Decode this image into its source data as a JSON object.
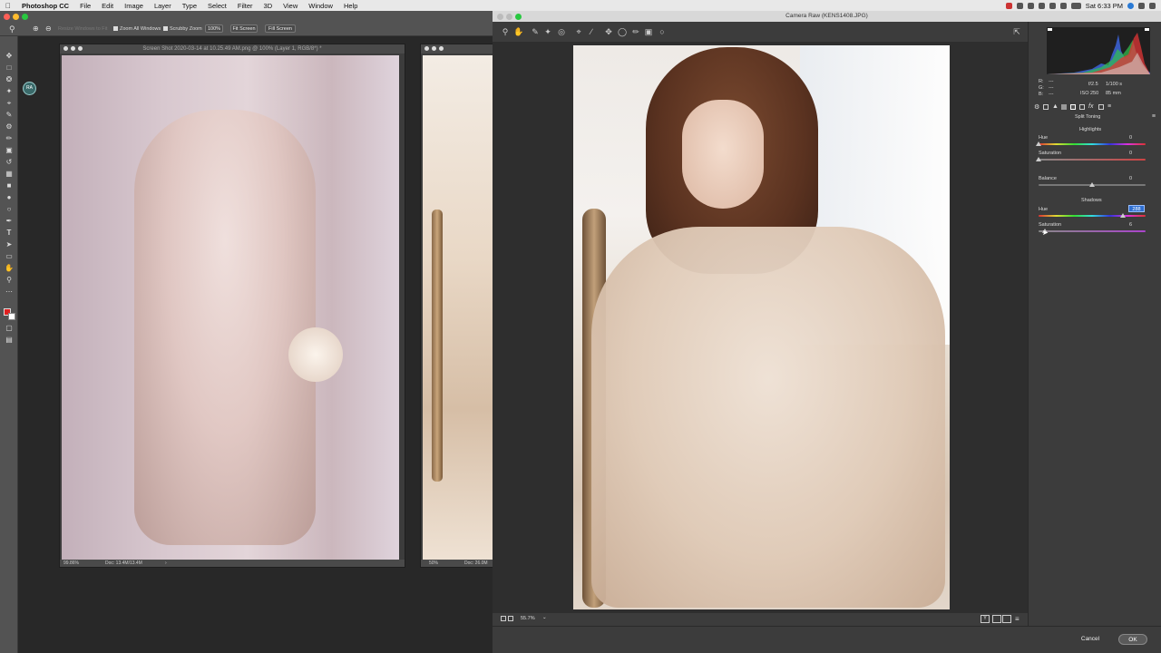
{
  "menubar": {
    "app": "Photoshop CC",
    "items": [
      "File",
      "Edit",
      "Image",
      "Layer",
      "Type",
      "Select",
      "Filter",
      "3D",
      "View",
      "Window",
      "Help"
    ],
    "clock": "Sat 6:33 PM"
  },
  "options_bar": {
    "resize_windows": "Resize Windows to Fit",
    "zoom_all": "Zoom All Windows",
    "scrubby": "Scrubby Zoom",
    "zoom_pct": "100%",
    "fit_screen": "Fit Screen",
    "fill_screen": "Fill Screen"
  },
  "doc1": {
    "title": "Screen Shot 2020-03-14 at 10.25.49 AM.png @ 100% (Layer 1, RGB/8*) *",
    "zoom": "99.86%",
    "doc_size": "Doc: 13.4M/13.4M"
  },
  "doc2": {
    "zoom": "50%",
    "doc_size": "Doc: 26.0M"
  },
  "camera_raw": {
    "title": "Camera Raw (KENS1408.JPG)",
    "zoom": "55.7%",
    "cancel": "Cancel",
    "ok": "OK"
  },
  "panel": {
    "rgb": {
      "r_label": "R:",
      "g_label": "G:",
      "b_label": "B:",
      "r": "---",
      "g": "---",
      "b": "---"
    },
    "exif": {
      "aperture": "f/2.5",
      "shutter": "1/100 s",
      "iso": "ISO 250",
      "focal": "85 mm"
    },
    "section_title": "Split Toning",
    "highlights": "Highlights",
    "h_hue_label": "Hue",
    "h_hue": "0",
    "h_sat_label": "Saturation",
    "h_sat": "0",
    "balance_label": "Balance",
    "balance": "0",
    "shadows": "Shadows",
    "s_hue_label": "Hue",
    "s_hue": "288",
    "s_sat_label": "Saturation",
    "s_sat": "6"
  },
  "colors": {
    "accent": "#2f6fd1",
    "close": "#fe5f57",
    "minimize": "#febc2e",
    "zoom": "#28c840"
  }
}
